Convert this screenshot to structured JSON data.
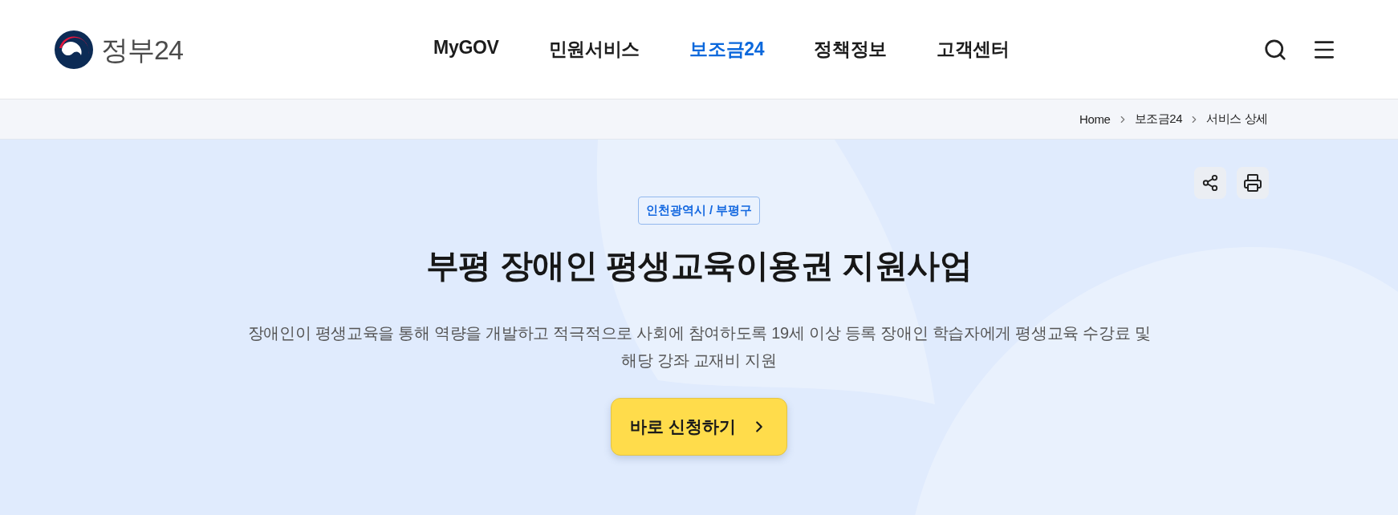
{
  "header": {
    "logo": {
      "text": "정부24"
    },
    "nav": [
      {
        "label": "MyGOV",
        "selected": false
      },
      {
        "label": "민원서비스",
        "selected": false
      },
      {
        "label": "보조금24",
        "selected": true
      },
      {
        "label": "정책정보",
        "selected": false
      },
      {
        "label": "고객센터",
        "selected": false
      }
    ]
  },
  "breadcrumb": [
    "Home",
    "보조금24",
    "서비스 상세"
  ],
  "hero": {
    "tag": "인천광역시 / 부평구",
    "title": "부평 장애인 평생교육이용권 지원사업",
    "description": "장애인이 평생교육을 통해 역량을 개발하고 적극적으로 사회에 참여하도록 19세 이상 등록 장애인 학습자에게 평생교육 수강료 및 해당 강좌 교재비 지원",
    "apply_button": "바로 신청하기"
  }
}
